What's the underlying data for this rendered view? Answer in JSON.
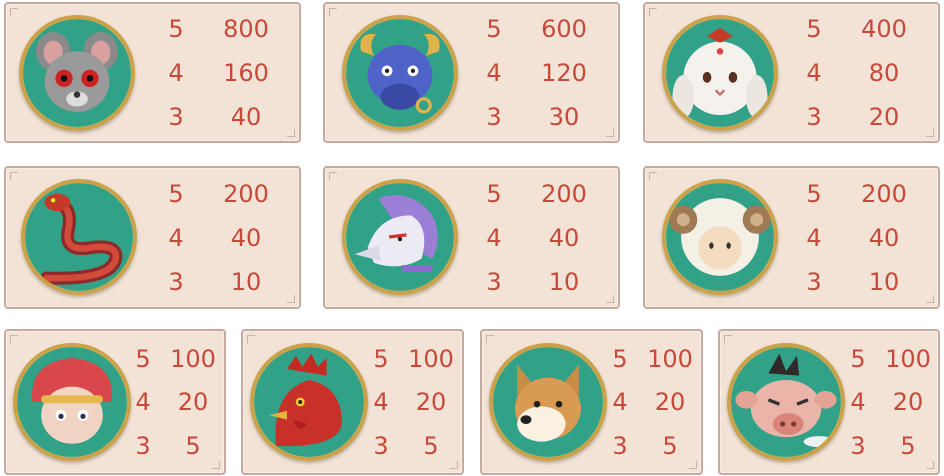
{
  "colors": {
    "card_bg": "#f3e3d6",
    "card_border": "#c4aaa0",
    "number_color": "#c6493a",
    "icon_ring": "#caa24a",
    "icon_fill": "#31a287"
  },
  "symbols": [
    {
      "name": "rat",
      "icon": "rat-icon",
      "pays": [
        {
          "count": "5",
          "value": "800"
        },
        {
          "count": "4",
          "value": "160"
        },
        {
          "count": "3",
          "value": "40"
        }
      ]
    },
    {
      "name": "ox",
      "icon": "ox-icon",
      "pays": [
        {
          "count": "5",
          "value": "600"
        },
        {
          "count": "4",
          "value": "120"
        },
        {
          "count": "3",
          "value": "30"
        }
      ]
    },
    {
      "name": "rabbit",
      "icon": "rabbit-icon",
      "pays": [
        {
          "count": "5",
          "value": "400"
        },
        {
          "count": "4",
          "value": "80"
        },
        {
          "count": "3",
          "value": "20"
        }
      ]
    },
    {
      "name": "snake",
      "icon": "snake-icon",
      "pays": [
        {
          "count": "5",
          "value": "200"
        },
        {
          "count": "4",
          "value": "40"
        },
        {
          "count": "3",
          "value": "10"
        }
      ]
    },
    {
      "name": "horse",
      "icon": "horse-icon",
      "pays": [
        {
          "count": "5",
          "value": "200"
        },
        {
          "count": "4",
          "value": "40"
        },
        {
          "count": "3",
          "value": "10"
        }
      ]
    },
    {
      "name": "goat",
      "icon": "goat-icon",
      "pays": [
        {
          "count": "5",
          "value": "200"
        },
        {
          "count": "4",
          "value": "40"
        },
        {
          "count": "3",
          "value": "10"
        }
      ]
    },
    {
      "name": "monkey",
      "icon": "monkey-icon",
      "pays": [
        {
          "count": "5",
          "value": "100"
        },
        {
          "count": "4",
          "value": "20"
        },
        {
          "count": "3",
          "value": "5"
        }
      ]
    },
    {
      "name": "rooster",
      "icon": "rooster-icon",
      "pays": [
        {
          "count": "5",
          "value": "100"
        },
        {
          "count": "4",
          "value": "20"
        },
        {
          "count": "3",
          "value": "5"
        }
      ]
    },
    {
      "name": "dog",
      "icon": "dog-icon",
      "pays": [
        {
          "count": "5",
          "value": "100"
        },
        {
          "count": "4",
          "value": "20"
        },
        {
          "count": "3",
          "value": "5"
        }
      ]
    },
    {
      "name": "pig",
      "icon": "pig-icon",
      "pays": [
        {
          "count": "5",
          "value": "100"
        },
        {
          "count": "4",
          "value": "20"
        },
        {
          "count": "3",
          "value": "5"
        }
      ]
    }
  ]
}
